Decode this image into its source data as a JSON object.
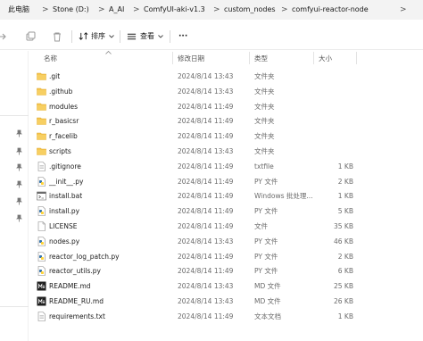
{
  "breadcrumb": {
    "items": [
      "此电脑",
      "Stone (D:)",
      "A_AI",
      "ComfyUI-aki-v1.3",
      "custom_nodes",
      "comfyui-reactor-node"
    ],
    "separator": ">"
  },
  "toolbar": {
    "sort_label": "排序",
    "view_label": "查看",
    "more_label": "···"
  },
  "columns": {
    "name": "名称",
    "date": "修改日期",
    "type": "类型",
    "size": "大小"
  },
  "files": [
    {
      "name": ".git",
      "date": "2024/8/14 13:43",
      "type": "文件夹",
      "size": "",
      "icon": "folder-icon"
    },
    {
      "name": ".github",
      "date": "2024/8/14 13:43",
      "type": "文件夹",
      "size": "",
      "icon": "folder-icon"
    },
    {
      "name": "modules",
      "date": "2024/8/14 11:49",
      "type": "文件夹",
      "size": "",
      "icon": "folder-icon"
    },
    {
      "name": "r_basicsr",
      "date": "2024/8/14 11:49",
      "type": "文件夹",
      "size": "",
      "icon": "folder-icon"
    },
    {
      "name": "r_facelib",
      "date": "2024/8/14 11:49",
      "type": "文件夹",
      "size": "",
      "icon": "folder-icon"
    },
    {
      "name": "scripts",
      "date": "2024/8/14 13:43",
      "type": "文件夹",
      "size": "",
      "icon": "folder-icon"
    },
    {
      "name": ".gitignore",
      "date": "2024/8/14 11:49",
      "type": "txtfile",
      "size": "1 KB",
      "icon": "text-file-icon"
    },
    {
      "name": "__init__.py",
      "date": "2024/8/14 11:49",
      "type": "PY 文件",
      "size": "2 KB",
      "icon": "python-file-icon"
    },
    {
      "name": "install.bat",
      "date": "2024/8/14 11:49",
      "type": "Windows 批处理...",
      "size": "1 KB",
      "icon": "batch-file-icon"
    },
    {
      "name": "install.py",
      "date": "2024/8/14 11:49",
      "type": "PY 文件",
      "size": "5 KB",
      "icon": "python-file-icon"
    },
    {
      "name": "LICENSE",
      "date": "2024/8/14 11:49",
      "type": "文件",
      "size": "35 KB",
      "icon": "blank-file-icon"
    },
    {
      "name": "nodes.py",
      "date": "2024/8/14 13:43",
      "type": "PY 文件",
      "size": "46 KB",
      "icon": "python-file-icon"
    },
    {
      "name": "reactor_log_patch.py",
      "date": "2024/8/14 11:49",
      "type": "PY 文件",
      "size": "2 KB",
      "icon": "python-file-icon"
    },
    {
      "name": "reactor_utils.py",
      "date": "2024/8/14 11:49",
      "type": "PY 文件",
      "size": "6 KB",
      "icon": "python-file-icon"
    },
    {
      "name": "README.md",
      "date": "2024/8/14 13:43",
      "type": "MD 文件",
      "size": "25 KB",
      "icon": "markdown-file-icon"
    },
    {
      "name": "README_RU.md",
      "date": "2024/8/14 13:43",
      "type": "MD 文件",
      "size": "26 KB",
      "icon": "markdown-file-icon"
    },
    {
      "name": "requirements.txt",
      "date": "2024/8/14 11:49",
      "type": "文本文档",
      "size": "1 KB",
      "icon": "text-file-icon"
    }
  ],
  "colors": {
    "folder": "#f5c64f",
    "folder_dark": "#e0a82e",
    "python": "#3776ab",
    "python_yellow": "#ffd43b",
    "markdown": "#1f1f1f",
    "accent": "#0067c0"
  }
}
